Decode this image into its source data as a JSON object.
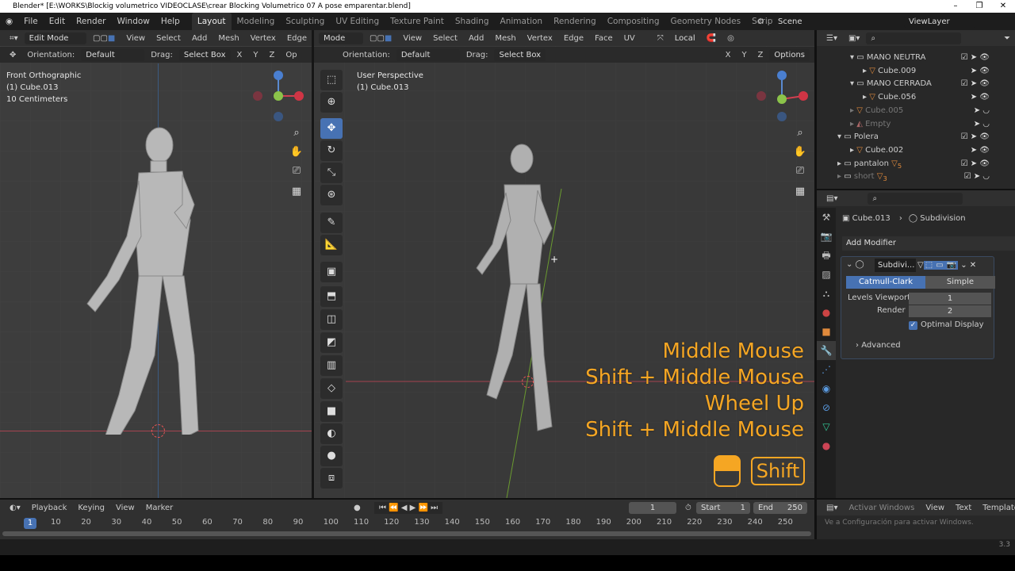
{
  "window": {
    "title": "Blender* [E:\\WORKS\\Blockig volumetrico VIDEOCLASE\\crear Blocking Volumetrico 07 A pose emparentar.blend]",
    "controls": [
      "–",
      "❐",
      "✕"
    ]
  },
  "menu": [
    "File",
    "Edit",
    "Render",
    "Window",
    "Help"
  ],
  "workspaces": [
    {
      "label": "Layout",
      "active": true
    },
    {
      "label": "Modeling"
    },
    {
      "label": "Sculpting"
    },
    {
      "label": "UV Editing"
    },
    {
      "label": "Texture Paint"
    },
    {
      "label": "Shading"
    },
    {
      "label": "Animation"
    },
    {
      "label": "Rendering"
    },
    {
      "label": "Compositing"
    },
    {
      "label": "Geometry Nodes"
    },
    {
      "label": "Scripting"
    }
  ],
  "scene": "Scene",
  "view_layer": "ViewLayer",
  "left_view": {
    "mode": "Edit Mode",
    "menus": [
      "View",
      "Select",
      "Add",
      "Mesh",
      "Vertex",
      "Edge"
    ],
    "orientation_label": "Orientation:",
    "orientation": "Default",
    "drag_label": "Drag:",
    "drag": "Select Box",
    "axes": [
      "X",
      "Y",
      "Z"
    ],
    "options_cut": "Op",
    "info": [
      "Front Orthographic",
      "(1) Cube.013",
      "10 Centimeters"
    ]
  },
  "right_view": {
    "mode": "Mode",
    "menus": [
      "View",
      "Select",
      "Add",
      "Mesh",
      "Vertex",
      "Edge",
      "Face",
      "UV"
    ],
    "pivot": "Local",
    "orientation_label": "Orientation:",
    "orientation": "Default",
    "drag_label": "Drag:",
    "drag": "Select Box",
    "axes": [
      "X",
      "Y",
      "Z"
    ],
    "options": "Options",
    "info": [
      "User Perspective",
      "(1) Cube.013"
    ]
  },
  "overlay": {
    "lines": [
      "Middle Mouse",
      "Shift + Middle Mouse",
      "Wheel Up",
      "Shift + Middle Mouse"
    ],
    "key": "Shift",
    "color": "#f5a623"
  },
  "outliner": {
    "rows": [
      {
        "label": "MANO NEUTRA",
        "type": "collection",
        "indent": 2
      },
      {
        "label": "Cube.009",
        "type": "mesh",
        "indent": 3
      },
      {
        "label": "MANO CERRADA",
        "type": "collection",
        "indent": 2
      },
      {
        "label": "Cube.056",
        "type": "mesh",
        "indent": 3
      },
      {
        "label": "Cube.005",
        "type": "mesh",
        "indent": 2,
        "dim": true
      },
      {
        "label": "Empty",
        "type": "empty",
        "indent": 2,
        "dim": true
      },
      {
        "label": "Polera",
        "type": "collection",
        "indent": 1
      },
      {
        "label": "Cube.002",
        "type": "mesh",
        "indent": 2
      },
      {
        "label": "pantalon",
        "type": "collection",
        "indent": 1,
        "badge": "5"
      },
      {
        "label": "short",
        "type": "collection",
        "indent": 1,
        "dim": true,
        "badge": "3"
      }
    ]
  },
  "properties": {
    "breadcrumb": [
      "Cube.013",
      "Subdivision"
    ],
    "add_modifier": "Add Modifier",
    "modifier_name": "Subdivi...",
    "types": [
      "Catmull-Clark",
      "Simple"
    ],
    "levels_viewport_label": "Levels Viewport",
    "levels_viewport": "1",
    "render_label": "Render",
    "render": "2",
    "optimal_display": "Optimal Display",
    "optimal_checked": true,
    "advanced": "Advanced"
  },
  "timeline": {
    "menus": [
      "Playback",
      "Keying",
      "View",
      "Marker"
    ],
    "current_frame": "1",
    "start_label": "Start",
    "start": "1",
    "end_label": "End",
    "end": "250",
    "ticks": [
      "10",
      "20",
      "30",
      "40",
      "50",
      "60",
      "70",
      "80",
      "90",
      "100",
      "110",
      "120",
      "130",
      "140",
      "150",
      "160",
      "170",
      "180",
      "190",
      "200",
      "210",
      "220",
      "230",
      "240",
      "250"
    ],
    "cursor": "1"
  },
  "text_editor": {
    "labels": [
      "View",
      "Text",
      "Templates"
    ],
    "watermark_title": "Activar Windows",
    "watermark": "Ve a Configuración para activar Windows."
  },
  "version": "3.3"
}
